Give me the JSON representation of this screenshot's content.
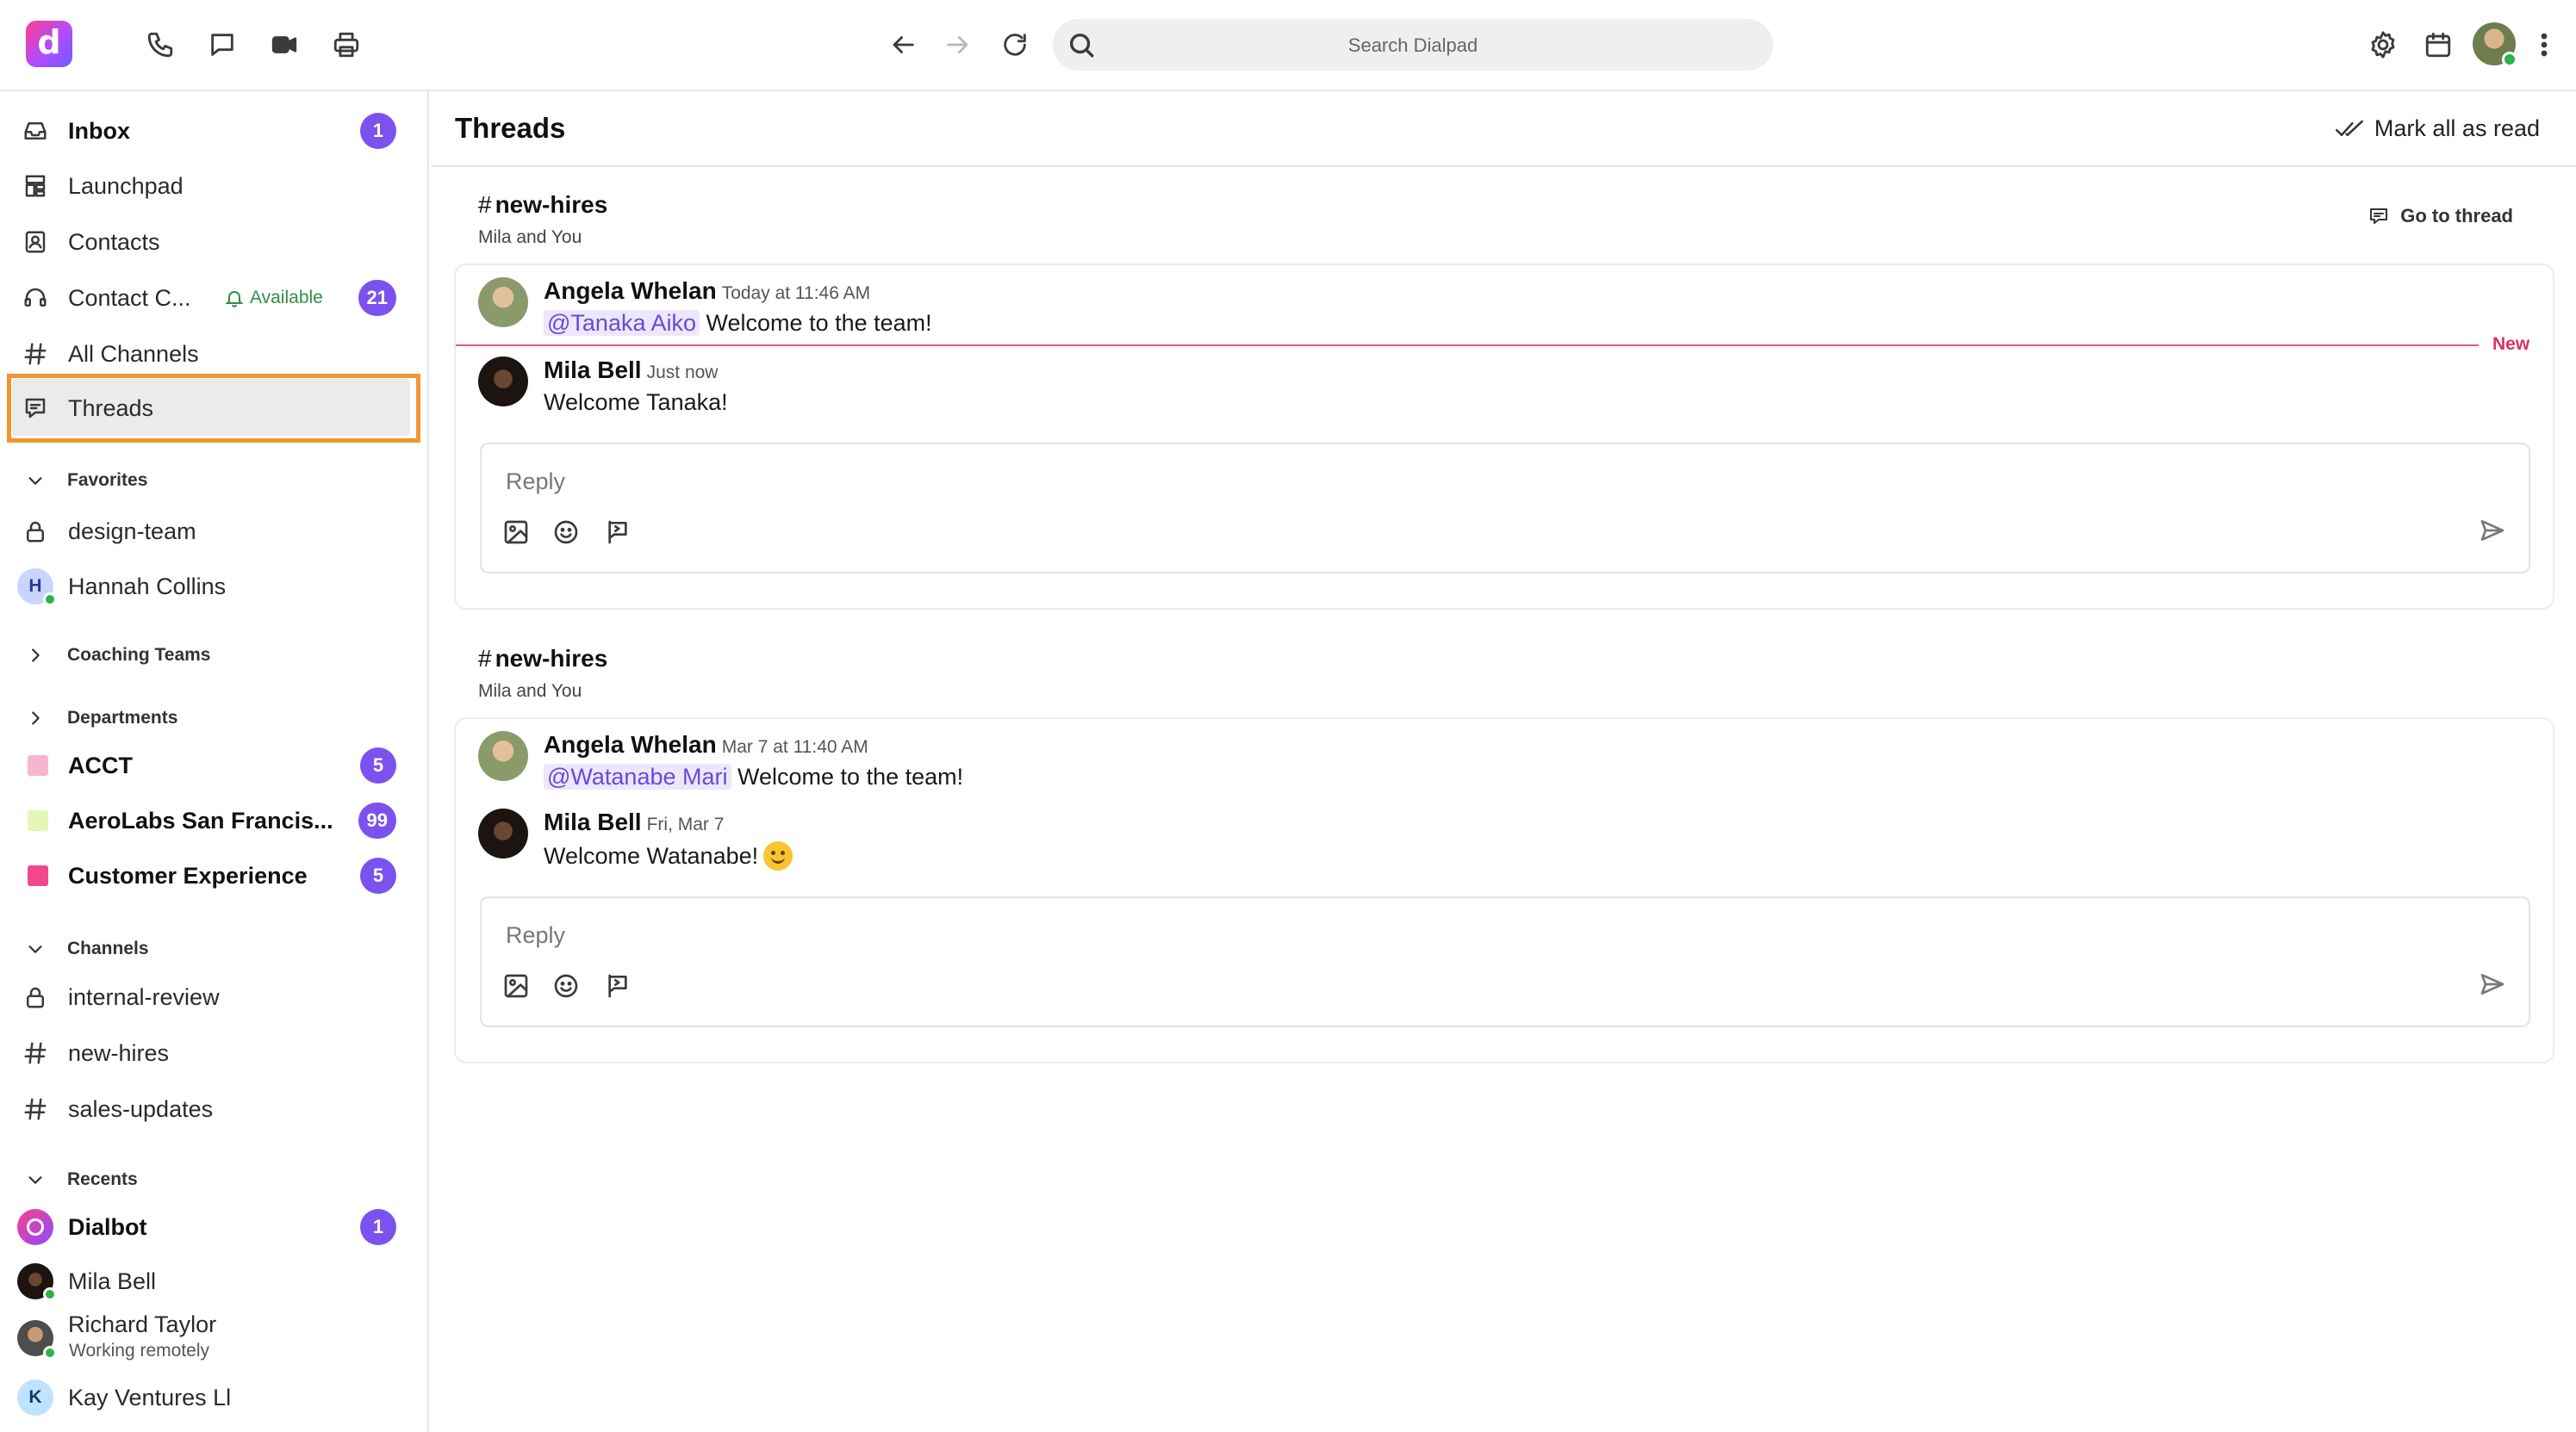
{
  "app": {
    "logo_letter": "d",
    "brand_color": "#7c52ee",
    "highlight_color": "#f0962e"
  },
  "topbar": {
    "search_placeholder": "Search Dialpad",
    "icons": [
      "phone-icon",
      "message-icon",
      "video-icon",
      "print-icon",
      "back-arrow-icon",
      "forward-arrow-icon",
      "refresh-icon",
      "search-icon",
      "settings-icon",
      "calendar-icon",
      "more-vertical-icon"
    ]
  },
  "sidebar": {
    "inbox": {
      "label": "Inbox",
      "badge": "1"
    },
    "launchpad": {
      "label": "Launchpad"
    },
    "contacts": {
      "label": "Contacts"
    },
    "contact_center": {
      "label": "Contact C...",
      "status": "Available",
      "badge": "21"
    },
    "all_channels": {
      "label": "All Channels"
    },
    "threads": {
      "label": "Threads"
    },
    "favorites": {
      "title": "Favorites",
      "items": [
        {
          "label": "design-team"
        },
        {
          "label": "Hannah Collins",
          "initial": "H"
        }
      ]
    },
    "coaching_teams": {
      "title": "Coaching Teams"
    },
    "departments": {
      "title": "Departments",
      "items": [
        {
          "label": "ACCT",
          "badge": "5",
          "color": "#f7b6cf"
        },
        {
          "label": "AeroLabs San Francis...",
          "badge": "99",
          "color": "#e4f7b5"
        },
        {
          "label": "Customer Experience",
          "badge": "5",
          "color": "#f0488c"
        }
      ]
    },
    "channels": {
      "title": "Channels",
      "items": [
        {
          "label": "internal-review"
        },
        {
          "label": "new-hires"
        },
        {
          "label": "sales-updates"
        }
      ]
    },
    "recents": {
      "title": "Recents",
      "items": [
        {
          "label": "Dialbot",
          "badge": "1"
        },
        {
          "label": "Mila Bell"
        },
        {
          "label": "Richard Taylor",
          "subtitle": "Working remotely"
        },
        {
          "label": "Kay Ventures Ll",
          "initial": "K"
        }
      ]
    }
  },
  "main": {
    "title": "Threads",
    "mark_all_read": "Mark all as read",
    "threads": [
      {
        "channel": "new-hires",
        "participants": "Mila and You",
        "go_to_thread": "Go to thread",
        "messages": [
          {
            "author": "Angela Whelan",
            "time": "Today at 11:46 AM",
            "mention": "@Tanaka Aiko",
            "text": "Welcome to the team!"
          },
          {
            "author": "Mila Bell",
            "time": "Just now",
            "text": "Welcome Tanaka!"
          }
        ],
        "new_marker": "New",
        "reply_placeholder": "Reply"
      },
      {
        "channel": "new-hires",
        "participants": "Mila and You",
        "messages": [
          {
            "author": "Angela Whelan",
            "time": "Mar 7 at 11:40 AM",
            "mention": "@Watanabe Mari",
            "text": "Welcome to the team!"
          },
          {
            "author": "Mila Bell",
            "time": "Fri, Mar 7",
            "text": "Welcome Watanabe!"
          }
        ],
        "reply_placeholder": "Reply"
      }
    ]
  }
}
